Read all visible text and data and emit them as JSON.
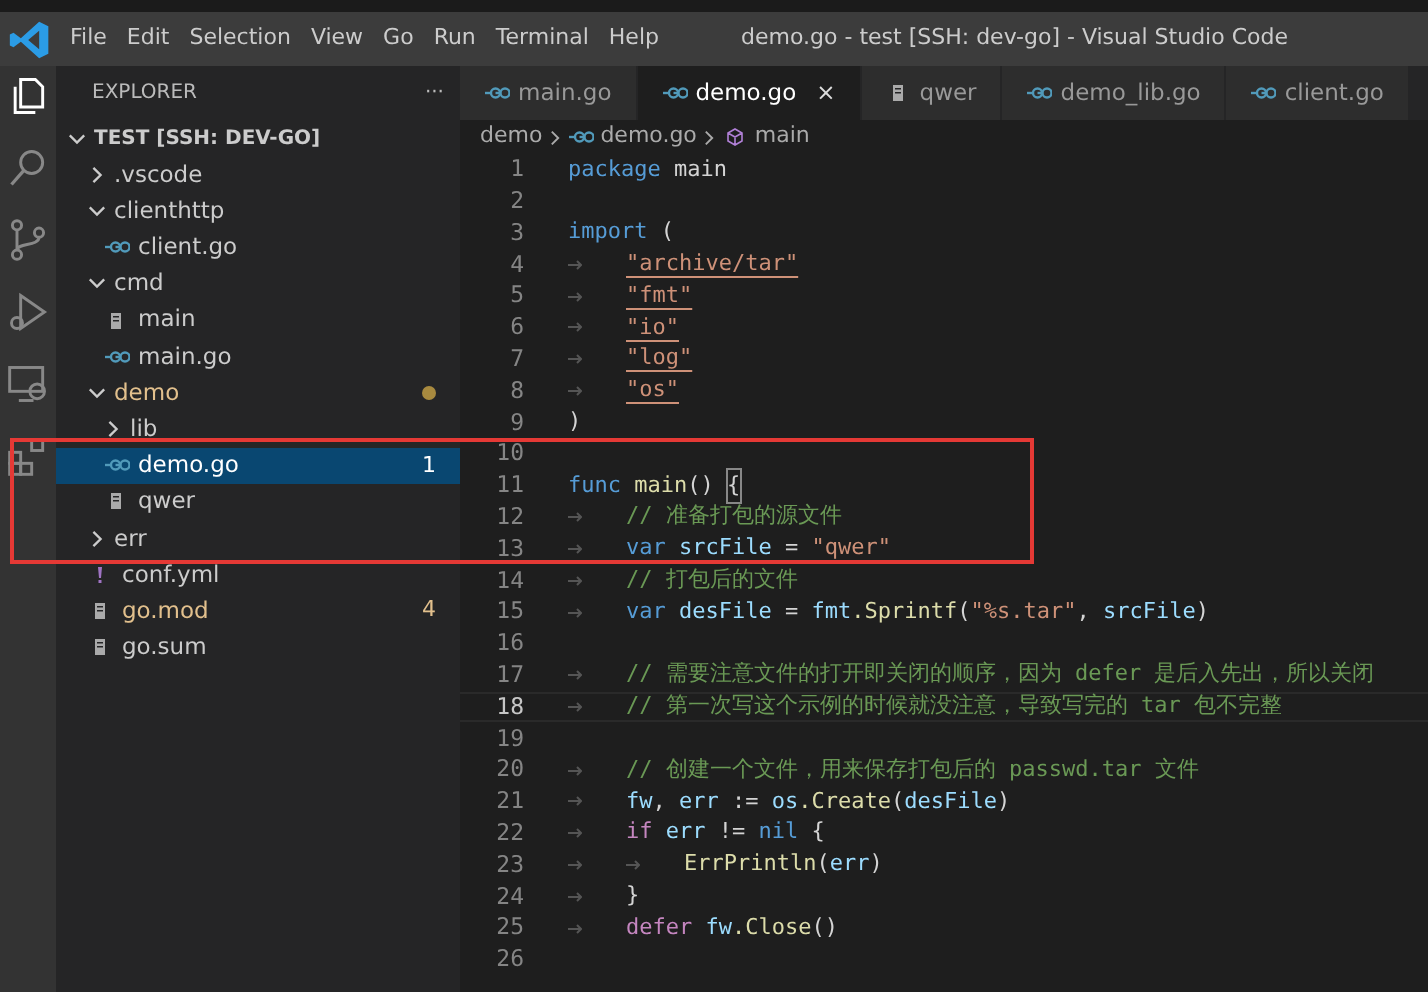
{
  "window": {
    "title": "demo.go - test [SSH: dev-go] - Visual Studio Code"
  },
  "menu": [
    "File",
    "Edit",
    "Selection",
    "View",
    "Go",
    "Run",
    "Terminal",
    "Help"
  ],
  "activity_bar": [
    {
      "kind": "files",
      "selected": true
    },
    {
      "kind": "search",
      "selected": false
    },
    {
      "kind": "source-control",
      "selected": false
    },
    {
      "kind": "run",
      "selected": false
    },
    {
      "kind": "remote",
      "selected": false
    },
    {
      "kind": "extensions",
      "selected": false
    }
  ],
  "sidebar": {
    "title": "EXPLORER",
    "more": "···",
    "root": {
      "label": "TEST [SSH: DEV-GO]",
      "expanded": true
    },
    "items": [
      {
        "label": ".vscode",
        "kind": "folder",
        "expanded": false,
        "selected": false,
        "modified": false
      },
      {
        "label": "clienthttp",
        "kind": "folder",
        "expanded": true,
        "selected": false,
        "modified": false,
        "children": [
          {
            "label": "client.go",
            "kind": "go",
            "selected": false,
            "modified": false
          }
        ]
      },
      {
        "label": "cmd",
        "kind": "folder",
        "expanded": true,
        "selected": false,
        "modified": false,
        "children": [
          {
            "label": "main",
            "kind": "file",
            "selected": false,
            "modified": false
          },
          {
            "label": "main.go",
            "kind": "go",
            "selected": false,
            "modified": false
          }
        ]
      },
      {
        "label": "demo",
        "kind": "folder",
        "expanded": true,
        "selected": false,
        "modified": true,
        "dot": true,
        "children": [
          {
            "label": "lib",
            "kind": "folder",
            "expanded": false,
            "selected": false,
            "modified": false
          },
          {
            "label": "demo.go",
            "kind": "go",
            "selected": true,
            "modified": false,
            "badge": "1"
          },
          {
            "label": "qwer",
            "kind": "file",
            "selected": false,
            "modified": false
          }
        ]
      },
      {
        "label": "err",
        "kind": "folder",
        "expanded": false,
        "selected": false,
        "modified": false
      },
      {
        "label": "conf.yml",
        "kind": "yaml",
        "selected": false,
        "modified": false
      },
      {
        "label": "go.mod",
        "kind": "file",
        "selected": false,
        "modified": true,
        "badge": "4"
      },
      {
        "label": "go.sum",
        "kind": "file",
        "selected": false,
        "modified": false
      }
    ]
  },
  "tabs": [
    {
      "label": "main.go",
      "kind": "go",
      "selected": false
    },
    {
      "label": "demo.go",
      "kind": "go",
      "selected": true,
      "close": "×"
    },
    {
      "label": "qwer",
      "kind": "file",
      "selected": false
    },
    {
      "label": "demo_lib.go",
      "kind": "go",
      "selected": false
    },
    {
      "label": "client.go",
      "kind": "go",
      "selected": false
    }
  ],
  "breadcrumb": [
    {
      "label": "demo",
      "kind": "folder"
    },
    {
      "label": "demo.go",
      "kind": "go"
    },
    {
      "label": "main",
      "kind": "symbol"
    }
  ],
  "editor": {
    "lines": [
      {
        "number": "1",
        "current": false,
        "tokens": [
          {
            "kind": "kw",
            "text": "package"
          },
          {
            "kind": "p",
            "text": " main"
          }
        ]
      },
      {
        "number": "2",
        "current": false
      },
      {
        "number": "3",
        "current": false,
        "tokens": [
          {
            "kind": "kw",
            "text": "import"
          },
          {
            "kind": "p",
            "text": " ("
          }
        ]
      },
      {
        "number": "4",
        "current": false,
        "tokens": [
          {
            "kind": "tab"
          },
          {
            "kind": "link",
            "text": "\"archive/tar\""
          }
        ]
      },
      {
        "number": "5",
        "current": false,
        "tokens": [
          {
            "kind": "tab"
          },
          {
            "kind": "link",
            "text": "\"fmt\""
          }
        ]
      },
      {
        "number": "6",
        "current": false,
        "tokens": [
          {
            "kind": "tab"
          },
          {
            "kind": "link",
            "text": "\"io\""
          }
        ]
      },
      {
        "number": "7",
        "current": false,
        "tokens": [
          {
            "kind": "tab"
          },
          {
            "kind": "link",
            "text": "\"log\""
          }
        ]
      },
      {
        "number": "8",
        "current": false,
        "tokens": [
          {
            "kind": "tab"
          },
          {
            "kind": "link",
            "text": "\"os\""
          }
        ]
      },
      {
        "number": "9",
        "current": false,
        "tokens": [
          {
            "kind": "p",
            "text": ")"
          }
        ]
      },
      {
        "number": "10",
        "current": false
      },
      {
        "number": "11",
        "current": false,
        "tokens": [
          {
            "kind": "kw",
            "text": "func"
          },
          {
            "kind": "fn",
            "text": " main"
          },
          {
            "kind": "p",
            "text": "() "
          },
          {
            "kind": "bracket",
            "text": "{"
          }
        ]
      },
      {
        "number": "12",
        "current": false,
        "tokens": [
          {
            "kind": "tab"
          },
          {
            "kind": "com",
            "text": "// 准备打包的源文件"
          }
        ]
      },
      {
        "number": "13",
        "current": false,
        "tokens": [
          {
            "kind": "tab"
          },
          {
            "kind": "kw",
            "text": "var"
          },
          {
            "kind": "var",
            "text": " srcFile"
          },
          {
            "kind": "p",
            "text": " = "
          },
          {
            "kind": "str",
            "text": "\"qwer\""
          }
        ]
      },
      {
        "number": "14",
        "current": false,
        "tokens": [
          {
            "kind": "tab"
          },
          {
            "kind": "com",
            "text": "// 打包后的文件"
          }
        ]
      },
      {
        "number": "15",
        "current": false,
        "tokens": [
          {
            "kind": "tab"
          },
          {
            "kind": "kw",
            "text": "var"
          },
          {
            "kind": "var",
            "text": " desFile"
          },
          {
            "kind": "p",
            "text": " = "
          },
          {
            "kind": "var",
            "text": "fmt"
          },
          {
            "kind": "fn",
            "text": ".Sprintf"
          },
          {
            "kind": "p",
            "text": "("
          },
          {
            "kind": "str",
            "text": "\"%s.tar\""
          },
          {
            "kind": "p",
            "text": ", "
          },
          {
            "kind": "var",
            "text": "srcFile"
          },
          {
            "kind": "p",
            "text": ")"
          }
        ]
      },
      {
        "number": "16",
        "current": false
      },
      {
        "number": "17",
        "current": false,
        "tokens": [
          {
            "kind": "tab"
          },
          {
            "kind": "com",
            "text": "// 需要注意文件的打开即关闭的顺序，因为 defer 是后入先出，所以关闭"
          }
        ]
      },
      {
        "number": "18",
        "current": true,
        "tokens": [
          {
            "kind": "tab"
          },
          {
            "kind": "com",
            "text": "// 第一次写这个示例的时候就没注意，导致写完的 tar 包不完整"
          }
        ]
      },
      {
        "number": "19",
        "current": false
      },
      {
        "number": "20",
        "current": false,
        "tokens": [
          {
            "kind": "tab"
          },
          {
            "kind": "com",
            "text": "// 创建一个文件，用来保存打包后的 passwd.tar 文件"
          }
        ]
      },
      {
        "number": "21",
        "current": false,
        "tokens": [
          {
            "kind": "tab"
          },
          {
            "kind": "var",
            "text": "fw"
          },
          {
            "kind": "p",
            "text": ", "
          },
          {
            "kind": "var",
            "text": "err"
          },
          {
            "kind": "p",
            "text": " := "
          },
          {
            "kind": "var",
            "text": "os"
          },
          {
            "kind": "fn",
            "text": ".Create"
          },
          {
            "kind": "p",
            "text": "("
          },
          {
            "kind": "var",
            "text": "desFile"
          },
          {
            "kind": "p",
            "text": ")"
          }
        ]
      },
      {
        "number": "22",
        "current": false,
        "tokens": [
          {
            "kind": "tab"
          },
          {
            "kind": "ctl",
            "text": "if"
          },
          {
            "kind": "var",
            "text": " err"
          },
          {
            "kind": "p",
            "text": " != "
          },
          {
            "kind": "kw",
            "text": "nil"
          },
          {
            "kind": "p",
            "text": " {"
          }
        ]
      },
      {
        "number": "23",
        "current": false,
        "tokens": [
          {
            "kind": "tab"
          },
          {
            "kind": "tab"
          },
          {
            "kind": "fn",
            "text": "ErrPrintln"
          },
          {
            "kind": "p",
            "text": "("
          },
          {
            "kind": "var",
            "text": "err"
          },
          {
            "kind": "p",
            "text": ")"
          }
        ]
      },
      {
        "number": "24",
        "current": false,
        "tokens": [
          {
            "kind": "tab"
          },
          {
            "kind": "p",
            "text": "}"
          }
        ]
      },
      {
        "number": "25",
        "current": false,
        "tokens": [
          {
            "kind": "tab"
          },
          {
            "kind": "ctl",
            "text": "defer"
          },
          {
            "kind": "var",
            "text": " fw"
          },
          {
            "kind": "fn",
            "text": ".Close"
          },
          {
            "kind": "p",
            "text": "()"
          }
        ]
      },
      {
        "number": "26",
        "current": false
      }
    ]
  }
}
